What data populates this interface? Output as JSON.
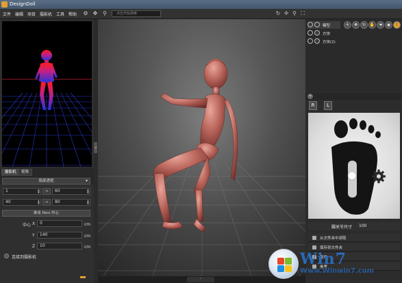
{
  "window": {
    "title": "DesignDoll"
  },
  "menu": {
    "items": [
      "文件",
      "编辑",
      "项目",
      "摄影机",
      "工具",
      "帮助"
    ],
    "search_placeholder": "点击开始搜索",
    "toolbar_icons": [
      "refresh-icon",
      "move-icon",
      "search-icon",
      "zoom-icon",
      "fit-icon"
    ]
  },
  "left_panel": {
    "tabs": [
      "摄影机",
      "视角"
    ],
    "projection": "局部透视",
    "row1": {
      "a": "1",
      "b": "60",
      "arrow": "->"
    },
    "row2": {
      "a": "40",
      "b": "80",
      "arrow": "->"
    },
    "center_button": "单击 Pers 中心",
    "center_label": "中心",
    "center": [
      {
        "axis": "X",
        "value": "0",
        "unit": "cm"
      },
      {
        "axis": "Y",
        "value": "140",
        "unit": "cm"
      },
      {
        "axis": "Z",
        "value": "10",
        "unit": "cm"
      }
    ],
    "connect_label": "连接到摄影机"
  },
  "right_panel": {
    "tree": [
      {
        "label": "模型",
        "selected": true
      },
      {
        "label": "方块",
        "selected": false
      },
      {
        "label": "方块(2)",
        "selected": false
      }
    ],
    "tool_icons": [
      "add-icon",
      "move-icon",
      "rotate-icon",
      "pose-icon",
      "hand-icon",
      "joint-icon",
      "info-icon"
    ],
    "plus_minus": "+",
    "lr_buttons": [
      "R",
      "L"
    ],
    "size_label": "踝关节尺寸",
    "size_value": "100",
    "buttons": [
      "从文件夹中读取",
      "保存到文件夹",
      "部件",
      "参考"
    ]
  },
  "watermark": {
    "big": "Win7",
    "small": "Www.Winwin7.com"
  },
  "colors": {
    "accent": "#e0a030",
    "grid_blue": "#2233cc",
    "figure": "#b86058"
  }
}
